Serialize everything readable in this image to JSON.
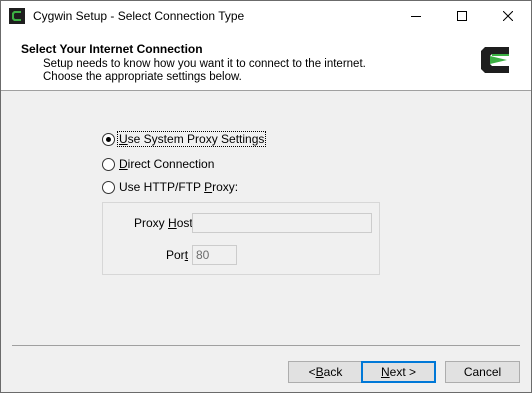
{
  "window": {
    "title": "Cygwin Setup - Select Connection Type",
    "controls": {
      "minimize_icon": "minimize-icon",
      "maximize_icon": "maximize-icon",
      "close_icon": "close-icon"
    }
  },
  "header": {
    "title": "Select Your Internet Connection",
    "description": "Setup needs to know how you want it to connect to the internet.  Choose the appropriate settings below.",
    "logo_icon": "cygwin-logo-icon"
  },
  "connection_options": [
    {
      "label_u": "U",
      "label_rest": "se System Proxy Settings",
      "selected": true
    },
    {
      "label_u": "D",
      "label_rest": "irect Connection",
      "selected": false
    },
    {
      "label_pre": "Use HTTP/FTP ",
      "label_u": "P",
      "label_rest": "roxy:",
      "selected": false
    }
  ],
  "proxy": {
    "host_label_pre": "Proxy ",
    "host_label_u": "H",
    "host_label_rest": "ost",
    "host_value": "",
    "port_label_pre": "Por",
    "port_label_u": "t",
    "port_value": "80"
  },
  "buttons": {
    "back_pre": "< ",
    "back_u": "B",
    "back_rest": "ack",
    "next_u": "N",
    "next_rest": "ext >",
    "cancel": "Cancel"
  },
  "colors": {
    "logo_green": "#3cb043",
    "logo_dark": "#1e1e1e",
    "accent": "#0078d7"
  }
}
